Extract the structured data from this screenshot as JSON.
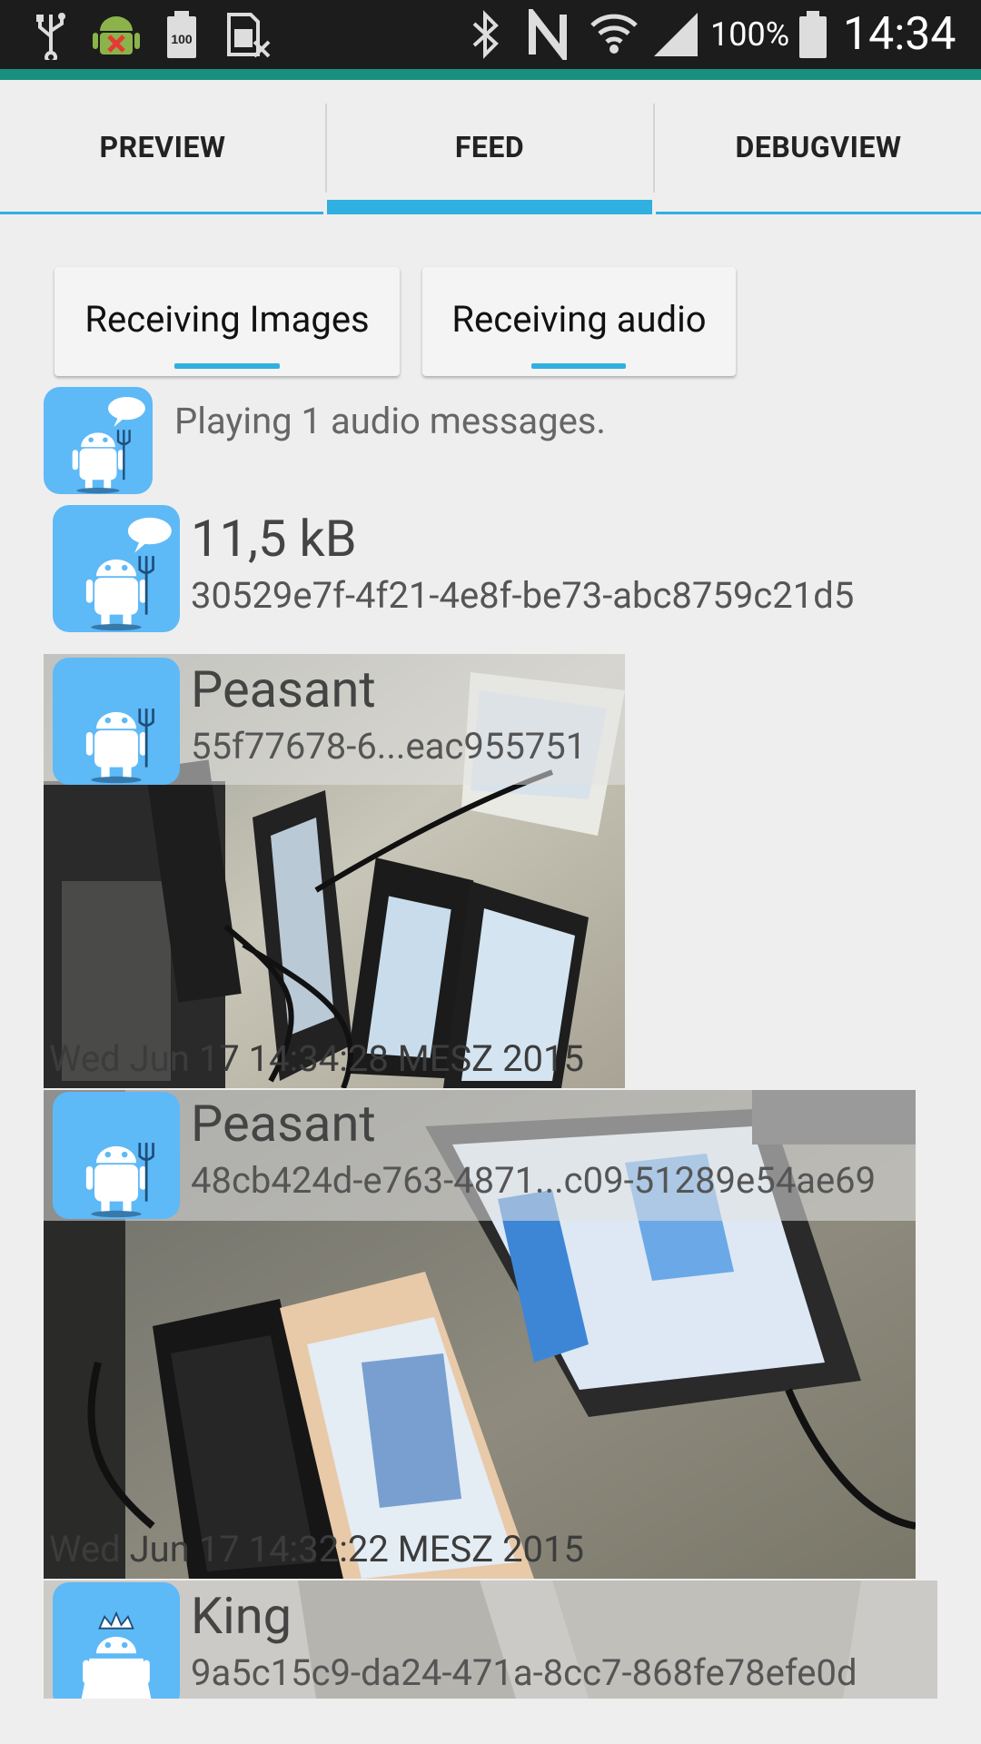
{
  "status_bar": {
    "battery_percent": "100%",
    "time": "14:34",
    "icons": [
      "usb-icon",
      "android-debug-icon",
      "battery-100-icon",
      "sim-off-icon",
      "bluetooth-icon",
      "nfc-icon",
      "wifi-icon",
      "signal-icon",
      "battery-icon"
    ]
  },
  "tabs": [
    {
      "label": "PREVIEW",
      "active": false
    },
    {
      "label": "FEED",
      "active": true
    },
    {
      "label": "DEBUGVIEW",
      "active": false
    }
  ],
  "toggles": {
    "images_label": "Receiving Images",
    "audio_label": "Receiving audio"
  },
  "feed": {
    "audio_status": "Playing 1 audio messages.",
    "file_item": {
      "size": "11,5 kB",
      "id": "30529e7f-4f21-4e8f-be73-abc8759c21d5"
    },
    "image_item_1": {
      "name": "Peasant",
      "id": "55f77678-6...eac955751",
      "date": "Wed Jun 17 14:34:28 MESZ 2015"
    },
    "image_item_2": {
      "name": "Peasant",
      "id": "48cb424d-e763-4871...c09-51289e54ae69",
      "date": "Wed Jun 17 14:32:22 MESZ 2015"
    },
    "image_item_3": {
      "name": "King",
      "id": "9a5c15c9-da24-471a-8cc7-868fe78efe0d"
    }
  },
  "colors": {
    "accent": "#2fb0e0",
    "status_accent": "#1a8f7f",
    "avatar": "#5eb9f7"
  }
}
